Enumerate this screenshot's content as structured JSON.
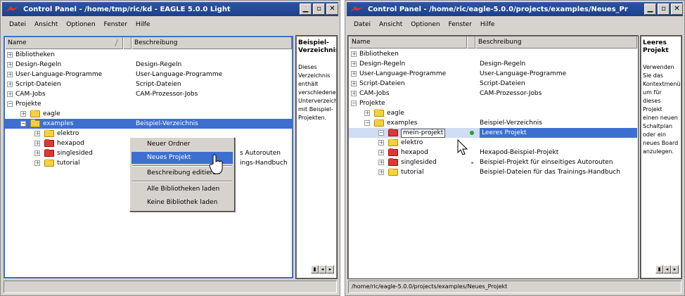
{
  "left_window": {
    "title": "Control Panel - /home/tmp/ric/kd - EAGLE 5.0.0 Light",
    "menu": [
      "Datei",
      "Ansicht",
      "Optionen",
      "Fenster",
      "Hilfe"
    ],
    "columns": {
      "name": "Name",
      "desc": "Beschreibung"
    },
    "rows": [
      {
        "label": "Bibliotheken",
        "desc": ""
      },
      {
        "label": "Design-Regeln",
        "desc": "Design-Regeln"
      },
      {
        "label": "User-Language-Programme",
        "desc": "User-Language-Programme"
      },
      {
        "label": "Script-Dateien",
        "desc": "Script-Dateien"
      },
      {
        "label": "CAM-Jobs",
        "desc": "CAM-Prozessor-Jobs"
      },
      {
        "label": "Projekte",
        "desc": ""
      },
      {
        "label": "eagle",
        "desc": ""
      },
      {
        "label": "examples",
        "desc": "Beispiel-Verzeichnis"
      },
      {
        "label": "elektro",
        "desc": ""
      },
      {
        "label": "hexapod",
        "desc": ""
      },
      {
        "label": "singlesided",
        "desc": "s Autorouten"
      },
      {
        "label": "tutorial",
        "desc": "ings-Handbuch"
      }
    ],
    "context_menu": [
      "Neuer Ordner",
      "Neues Projekt",
      "Beschreibung editieren",
      "Alle Bibliotheken laden",
      "Keine Bibliothek laden"
    ],
    "info_title": "Beispiel-Verzeichnis",
    "info_body": "Dieses Verzeichnis enthält verschiedene Unterverzeichnisse mit Beispiel-Projekten.",
    "status": ""
  },
  "right_window": {
    "title": "Control Panel - /home/ric/eagle-5.0.0/projects/examples/Neues_Pr",
    "menu": [
      "Datei",
      "Ansicht",
      "Optionen",
      "Fenster",
      "Hilfe"
    ],
    "columns": {
      "name": "Name",
      "desc": "Beschreibung"
    },
    "rows": [
      {
        "label": "Bibliotheken",
        "desc": ""
      },
      {
        "label": "Design-Regeln",
        "desc": "Design-Regeln"
      },
      {
        "label": "User-Language-Programme",
        "desc": "User-Language-Programme"
      },
      {
        "label": "Script-Dateien",
        "desc": "Script-Dateien"
      },
      {
        "label": "CAM-Jobs",
        "desc": "CAM-Prozessor-Jobs"
      },
      {
        "label": "Projekte",
        "desc": ""
      },
      {
        "label": "eagle",
        "desc": ""
      },
      {
        "label": "examples",
        "desc": "Beispiel-Verzeichnis"
      },
      {
        "label": "mein-projekt",
        "desc": "Leeres Projekt"
      },
      {
        "label": "elektro",
        "desc": ""
      },
      {
        "label": "hexapod",
        "desc": "Hexapod-Beispiel-Projekt"
      },
      {
        "label": "singlesided",
        "desc": "Beispiel-Projekt für einseitiges Autorouten"
      },
      {
        "label": "tutorial",
        "desc": "Beispiel-Dateien für das Trainings-Handbuch"
      }
    ],
    "info_title": "Leeres Projekt",
    "info_body": "Verwenden Sie das Kontextmenü um für dieses Projekt einen neuen Schaltplan oder ein neues Board anzulegen.",
    "status": "/home/ric/eagle-5.0.0/projects/examples/Neues_Projekt"
  },
  "colors": {
    "selection": "#3d6fd0",
    "titlebar": "#1c3f8a",
    "window_bg": "#d6d3ce",
    "folder_yellow": "#f5d13a",
    "folder_red": "#e23535"
  },
  "icons": [
    "eagle-app-icon",
    "minimize-icon",
    "maximize-icon",
    "close-icon",
    "expand-icon",
    "folder-icon",
    "project-folder-icon",
    "status-dot-icon",
    "arrow-cursor-icon"
  ]
}
